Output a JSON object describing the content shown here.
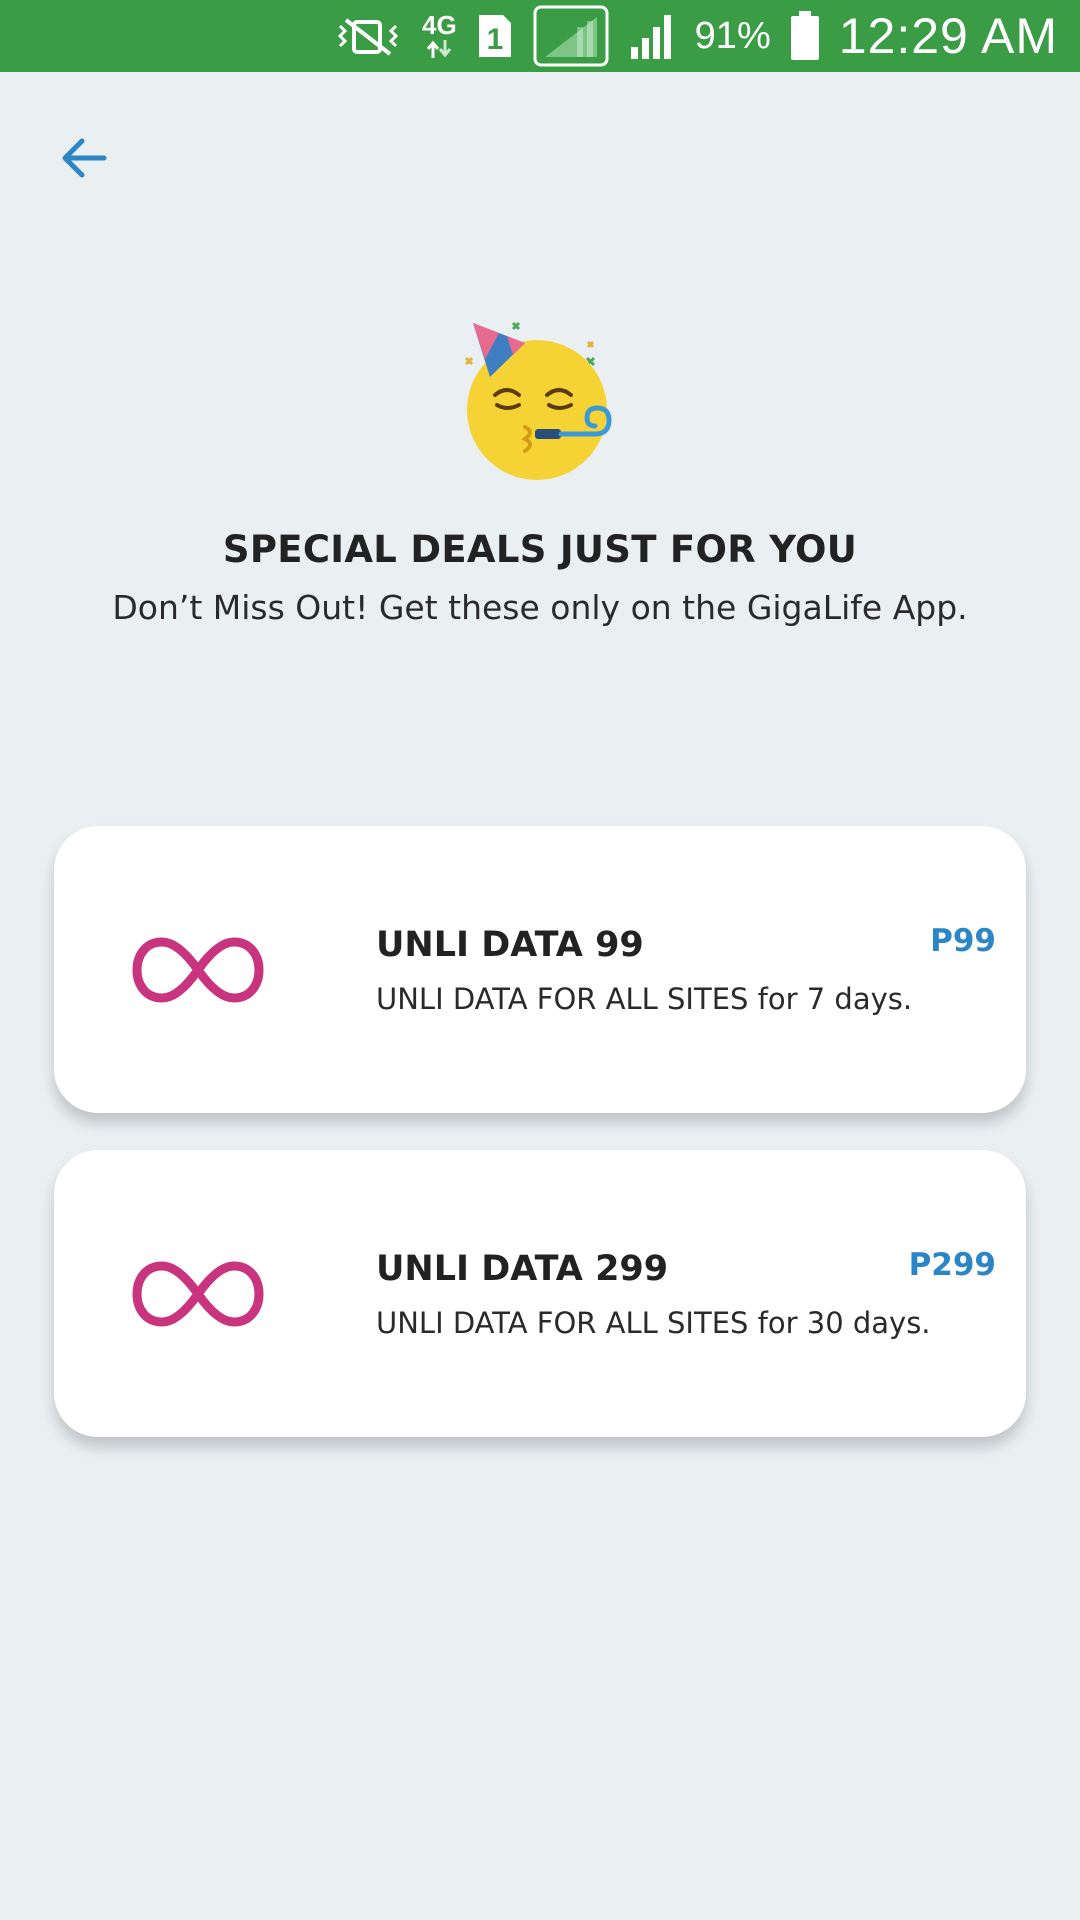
{
  "status_bar": {
    "network_type": "4G",
    "sim_slot": "1",
    "battery_percent": "91%",
    "time": "12:29 AM",
    "icons": [
      "vibrate-off-icon",
      "data-4g-icon",
      "sim-icon",
      "signal-sim1-icon",
      "signal-sim2-icon",
      "battery-icon"
    ]
  },
  "header": {
    "back_icon": "arrow-left-icon"
  },
  "hero": {
    "icon": "party-face-icon",
    "title": "SPECIAL DEALS JUST FOR YOU",
    "subtitle": "Don’t Miss Out! Get these only on the GigaLife App."
  },
  "deals": [
    {
      "icon": "infinity-icon",
      "title": "UNLI DATA 99",
      "description": "UNLI DATA FOR ALL SITES for 7 days.",
      "price": "P99"
    },
    {
      "icon": "infinity-icon",
      "title": "UNLI DATA 299",
      "description": "UNLI DATA FOR ALL SITES for 30 days.",
      "price": "P299"
    }
  ],
  "colors": {
    "status_bar": "#3a9c45",
    "background": "#eaeff2",
    "accent_blue": "#2c86c6",
    "infinity_pink": "#c8347e",
    "card": "#ffffff"
  }
}
